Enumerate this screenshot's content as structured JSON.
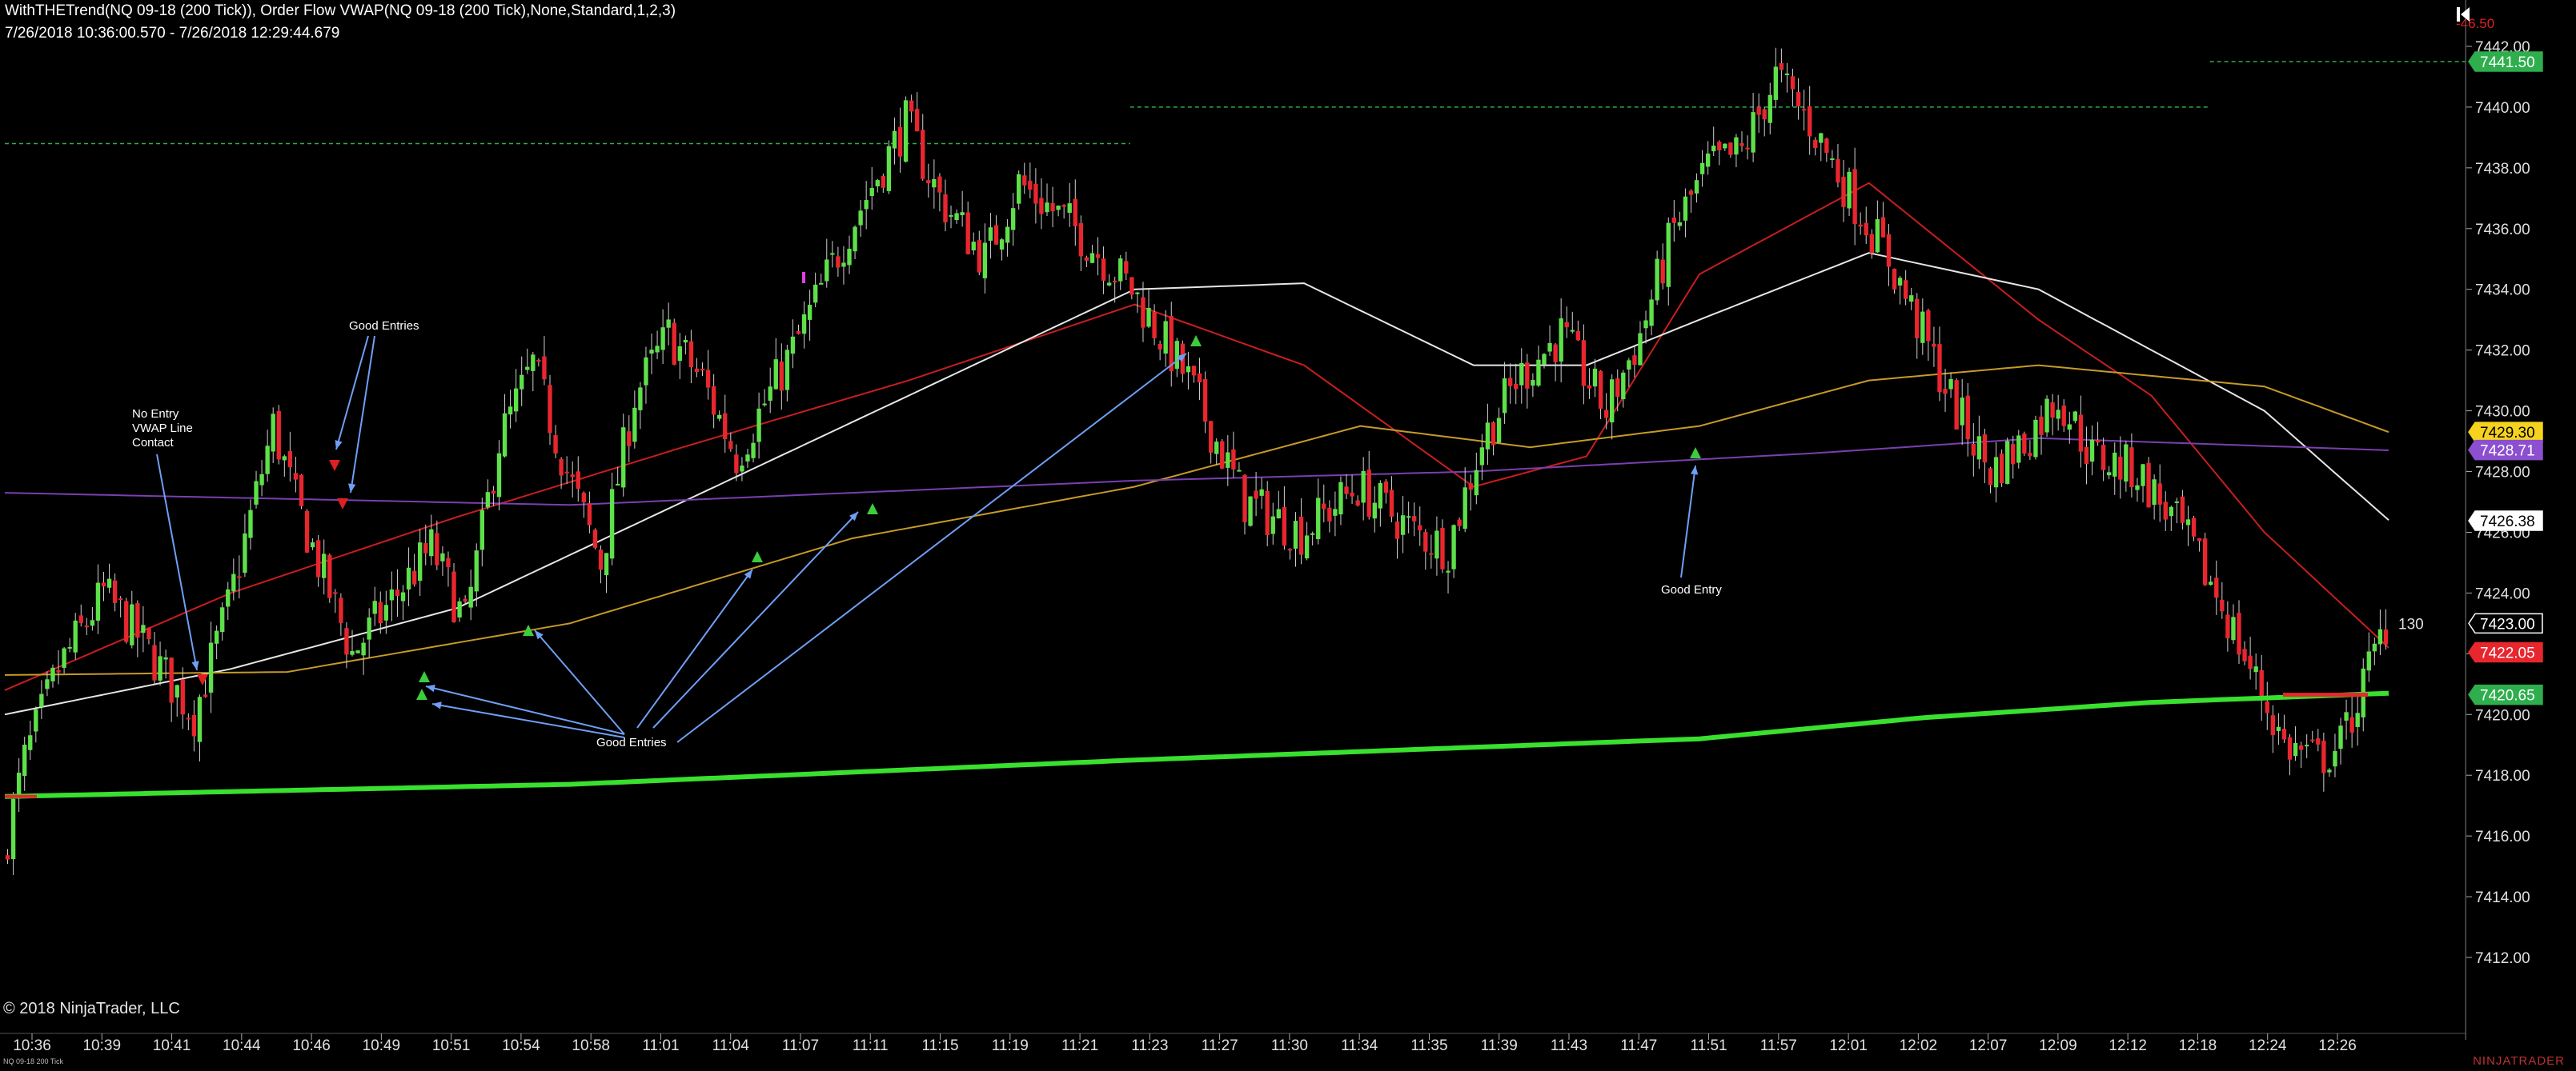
{
  "header": {
    "line1": "WithTHETrend(NQ 09-18 (200 Tick)), Order Flow VWAP(NQ 09-18 (200 Tick),None,Standard,1,2,3)",
    "line2": "7/26/2018 10:36:00.570 - 7/26/2018 12:29:44.679"
  },
  "footer": {
    "copyright": "© 2018 NinjaTrader, LLC",
    "instrument": "NQ 09-18 200 Tick",
    "brand": "NINJATRADER"
  },
  "colors": {
    "background": "#000000",
    "up_candle": "#5ee04a",
    "down_candle": "#e8262e",
    "vwap_green": "#39e02e",
    "ema_red": "#c81e1e",
    "sma_white": "#e6e6e6",
    "sma_gold": "#c79a28",
    "sma_purple": "#7a3fb0",
    "annotation_blue": "#6f9ff5"
  },
  "chart_data": {
    "type": "candlestick",
    "title": "",
    "xlabel": "",
    "ylabel": "",
    "ylim": [
      7411.0,
      7443.0
    ],
    "y_ticks": [
      "7412.00",
      "7414.00",
      "7416.00",
      "7418.00",
      "7420.00",
      "7422.00",
      "7424.00",
      "7426.00",
      "7428.00",
      "7430.00",
      "7432.00",
      "7434.00",
      "7436.00",
      "7438.00",
      "7440.00",
      "7442.00"
    ],
    "x_ticks": [
      "10:36",
      "10:39",
      "10:41",
      "10:44",
      "10:46",
      "10:49",
      "10:51",
      "10:54",
      "10:58",
      "11:01",
      "11:04",
      "11:07",
      "11:11",
      "11:15",
      "11:19",
      "11:21",
      "11:23",
      "11:27",
      "11:30",
      "11:34",
      "11:35",
      "11:39",
      "11:43",
      "11:47",
      "11:51",
      "11:57",
      "12:01",
      "12:02",
      "12:07",
      "12:09",
      "12:12",
      "12:18",
      "12:24",
      "12:26"
    ],
    "bar_count": 340,
    "closes_by_bar": [
      [
        0,
        7415.2
      ],
      [
        4,
        7418.5
      ],
      [
        10,
        7421.5
      ],
      [
        18,
        7424.0
      ],
      [
        24,
        7422.6
      ],
      [
        30,
        7421.0
      ],
      [
        34,
        7420.0
      ],
      [
        40,
        7423.5
      ],
      [
        44,
        7426.5
      ],
      [
        48,
        7429.5
      ],
      [
        52,
        7427.0
      ],
      [
        56,
        7425.0
      ],
      [
        62,
        7422.0
      ],
      [
        70,
        7424.0
      ],
      [
        76,
        7425.5
      ],
      [
        82,
        7423.0
      ],
      [
        88,
        7429.0
      ],
      [
        94,
        7431.5
      ],
      [
        100,
        7428.0
      ],
      [
        106,
        7425.0
      ],
      [
        112,
        7430.5
      ],
      [
        118,
        7432.5
      ],
      [
        124,
        7431.0
      ],
      [
        130,
        7428.5
      ],
      [
        140,
        7432.0
      ],
      [
        150,
        7436.0
      ],
      [
        160,
        7439.5
      ],
      [
        166,
        7437.0
      ],
      [
        174,
        7435.0
      ],
      [
        180,
        7437.5
      ],
      [
        190,
        7436.0
      ],
      [
        200,
        7434.0
      ],
      [
        210,
        7431.0
      ],
      [
        220,
        7427.0
      ],
      [
        230,
        7426.0
      ],
      [
        240,
        7427.5
      ],
      [
        250,
        7426.0
      ],
      [
        256,
        7425.5
      ],
      [
        262,
        7429.0
      ],
      [
        268,
        7431.0
      ],
      [
        276,
        7432.5
      ],
      [
        284,
        7430.0
      ],
      [
        290,
        7432.5
      ],
      [
        296,
        7436.0
      ],
      [
        302,
        7438.0
      ],
      [
        308,
        7438.5
      ],
      [
        314,
        7441.0
      ],
      [
        320,
        7439.5
      ],
      [
        326,
        7437.5
      ],
      [
        334,
        7435.0
      ],
      [
        340,
        7432.5
      ],
      [
        346,
        7430.0
      ],
      [
        352,
        7428.0
      ],
      [
        358,
        7429.0
      ],
      [
        364,
        7430.5
      ],
      [
        370,
        7428.5
      ],
      [
        378,
        7428.0
      ],
      [
        386,
        7426.0
      ],
      [
        392,
        7424.0
      ],
      [
        398,
        7421.5
      ],
      [
        404,
        7419.0
      ],
      [
        410,
        7418.5
      ],
      [
        414,
        7419.0
      ],
      [
        418,
        7421.0
      ],
      [
        422,
        7423.0
      ]
    ],
    "series": [
      {
        "name": "Order Flow VWAP",
        "points": [
          [
            0,
            7417.3
          ],
          [
            100,
            7417.7
          ],
          [
            200,
            7418.5
          ],
          [
            300,
            7419.2
          ],
          [
            340,
            7419.9
          ],
          [
            380,
            7420.4
          ],
          [
            422,
            7420.7
          ]
        ]
      },
      {
        "name": "",
        "points": [
          [
            0,
            7420.8
          ],
          [
            40,
            7424.0
          ],
          [
            80,
            7426.5
          ],
          [
            120,
            7428.8
          ],
          [
            160,
            7431.0
          ],
          [
            200,
            7433.5
          ],
          [
            230,
            7431.5
          ],
          [
            260,
            7427.5
          ],
          [
            280,
            7428.5
          ],
          [
            300,
            7434.5
          ],
          [
            330,
            7437.5
          ],
          [
            360,
            7433.0
          ],
          [
            380,
            7430.5
          ],
          [
            400,
            7426.0
          ],
          [
            422,
            7422.2
          ]
        ]
      },
      {
        "name": "",
        "points": [
          [
            0,
            7420.0
          ],
          [
            40,
            7421.5
          ],
          [
            80,
            7423.5
          ],
          [
            120,
            7427.0
          ],
          [
            160,
            7430.5
          ],
          [
            200,
            7434.0
          ],
          [
            230,
            7434.2
          ],
          [
            260,
            7431.5
          ],
          [
            280,
            7431.5
          ],
          [
            300,
            7433.0
          ],
          [
            330,
            7435.2
          ],
          [
            360,
            7434.0
          ],
          [
            380,
            7432.0
          ],
          [
            400,
            7430.0
          ],
          [
            422,
            7426.4
          ]
        ]
      },
      {
        "name": "",
        "points": [
          [
            0,
            7421.3
          ],
          [
            50,
            7421.4
          ],
          [
            100,
            7423.0
          ],
          [
            150,
            7425.8
          ],
          [
            200,
            7427.5
          ],
          [
            240,
            7429.5
          ],
          [
            270,
            7428.8
          ],
          [
            300,
            7429.5
          ],
          [
            330,
            7431.0
          ],
          [
            360,
            7431.5
          ],
          [
            400,
            7430.8
          ],
          [
            422,
            7429.3
          ]
        ]
      },
      {
        "name": "",
        "points": [
          [
            0,
            7427.3
          ],
          [
            100,
            7426.9
          ],
          [
            200,
            7427.7
          ],
          [
            260,
            7428.0
          ],
          [
            320,
            7428.6
          ],
          [
            360,
            7429.1
          ],
          [
            422,
            7428.7
          ]
        ]
      }
    ],
    "price_labels": [
      {
        "text": "7441.50",
        "color": "#2eae4c"
      },
      {
        "text": "7429.30",
        "color": "#f5d21e"
      },
      {
        "text": "7428.71",
        "color": "#8b4fd0"
      },
      {
        "text": "7426.38",
        "color": "#ffffff"
      },
      {
        "text": "7423.00",
        "color": "#000000"
      },
      {
        "text": "7422.05",
        "color": "#e8262e"
      },
      {
        "text": "7420.65",
        "color": "#2eae4c"
      }
    ],
    "pnl_label": "-46.50",
    "tick_counter": "130",
    "annotations": [
      {
        "text": "No Entry\nVWAP Line\nContact"
      },
      {
        "text": "Good Entries"
      },
      {
        "text": "Good Entries"
      },
      {
        "text": "Good Entry"
      }
    ]
  }
}
